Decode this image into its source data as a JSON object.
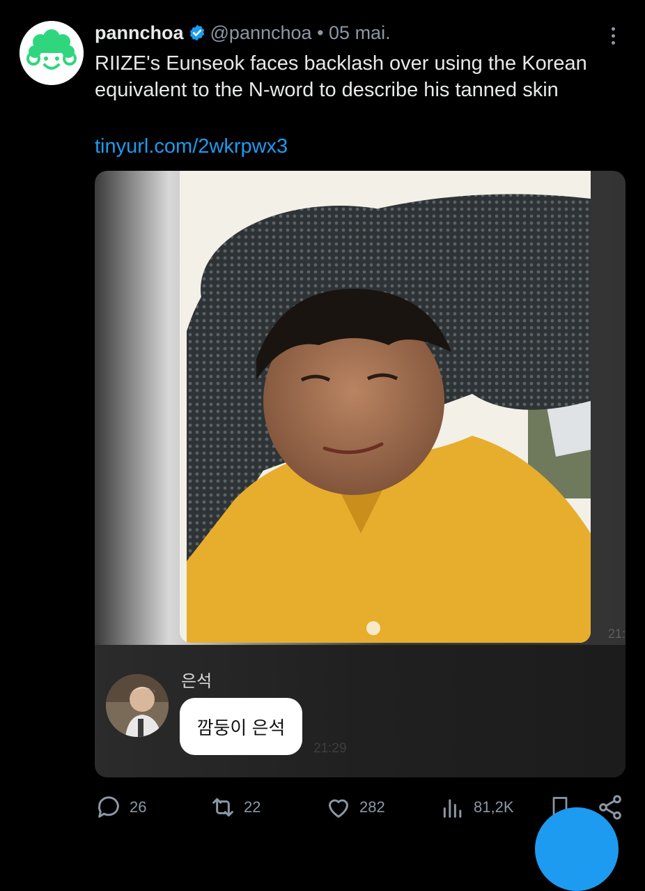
{
  "tweet": {
    "display_name": "pannchoa",
    "handle": "@pannchoa",
    "separator": "•",
    "date": "05 mai.",
    "text": "RIIZE's Eunseok faces backlash over using the Korean equivalent to the N-word to describe his tanned skin",
    "link": "tinyurl.com/2wkrpwx3"
  },
  "media": {
    "time_right": "21:",
    "sender": "은석",
    "message": "깜둥이 은석",
    "message_time": "21:29"
  },
  "actions": {
    "replies": "26",
    "reposts": "22",
    "likes": "282",
    "views": "81,2K"
  },
  "colors": {
    "background": "#000000",
    "accent": "#1d9bf0",
    "muted": "#8b98a5",
    "avatar_green": "#2fd67d"
  },
  "icons": [
    "verified-badge-icon",
    "more-icon",
    "reply-icon",
    "repost-icon",
    "like-icon",
    "views-icon",
    "bookmark-icon",
    "share-icon"
  ]
}
